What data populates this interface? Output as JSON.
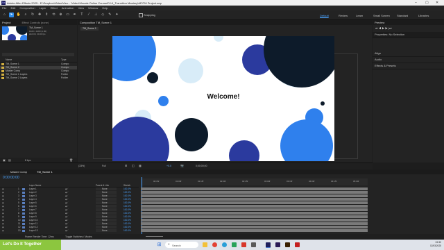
{
  "window": {
    "title": "Adobe After Effects 2025 - E:\\Dropbox\\Video\\Visu... \\Video\\Visuals Online Course\\D.UI_Transition Mastery\\AE\\TM Project.aep"
  },
  "menu": [
    "File",
    "Edit",
    "Composition",
    "Layer",
    "Effect",
    "Animation",
    "View",
    "Window",
    "Help"
  ],
  "toolbar": {
    "snapping_label": "Snapping"
  },
  "workspaces": [
    "Default",
    "Review",
    "Learn",
    "Small Screen",
    "Standard",
    "Libraries"
  ],
  "project": {
    "tab": "Project",
    "comp_name": "TM_Scene 1",
    "comp_info": [
      "1920 x 1080 (1.00)",
      "Δ10:00, 30.00 fps"
    ],
    "effect_controls_tab": "Effect Controls (none)",
    "col_name": "Name",
    "col_type": "Type",
    "items": [
      {
        "name": "TM_Scene 1",
        "type": "Compo",
        "color": "#d4b040",
        "selected": false
      },
      {
        "name": "TM_Scene 2",
        "type": "Compo",
        "color": "#d4b040",
        "selected": true
      },
      {
        "name": "Master Comp",
        "type": "Compo",
        "color": "#d4b040",
        "selected": false
      },
      {
        "name": "TM_Scene 1 Layers",
        "type": "Folder",
        "color": "#d4b040",
        "selected": false
      },
      {
        "name": "TM_Scene 2 Layers",
        "type": "Folder",
        "color": "#d4b040",
        "selected": false
      }
    ],
    "bpc": "8 bpc"
  },
  "viewer": {
    "tab": "Composition TM_Scene 1",
    "subtab": "TM_Scene 1",
    "welcome_text": "Welcome!",
    "zoom": "(33%)",
    "quality": "Full",
    "timecode": "0;00;00;00",
    "exposure": "+0.0"
  },
  "right_panel": {
    "preview_tab": "Preview",
    "properties_title": "Properties: No Selection",
    "sections": [
      "Align",
      "Audio",
      "Effects & Presets"
    ]
  },
  "timeline": {
    "tabs": [
      "Master Comp",
      "TM_Scene 1"
    ],
    "timecode": "0:00:00:00",
    "col_source": "Layer Name",
    "col_parent": "Parent & Link",
    "col_stretch": "Stretch",
    "ruler": [
      "00:15f",
      "01:00f",
      "01:15f",
      "02:00f",
      "02:15f",
      "03:00f",
      "03:15f",
      "04:00f",
      "04:15f",
      "05:00f"
    ],
    "layers": [
      {
        "num": "1",
        "name": "Layer 1",
        "parent": "None",
        "stretch": "100.0%"
      },
      {
        "num": "2",
        "name": "Layer 2",
        "parent": "None",
        "stretch": "100.0%"
      },
      {
        "num": "3",
        "name": "Layer 3",
        "parent": "None",
        "stretch": "100.0%"
      },
      {
        "num": "4",
        "name": "Layer 4",
        "parent": "None",
        "stretch": "100.0%"
      },
      {
        "num": "5",
        "name": "Layer 5",
        "parent": "None",
        "stretch": "100.0%"
      },
      {
        "num": "6",
        "name": "Layer 6",
        "parent": "None",
        "stretch": "100.0%"
      },
      {
        "num": "7",
        "name": "Layer 7",
        "parent": "None",
        "stretch": "100.0%"
      },
      {
        "num": "8",
        "name": "Layer 8",
        "parent": "None",
        "stretch": "100.0%"
      },
      {
        "num": "9",
        "name": "Layer 9",
        "parent": "None",
        "stretch": "100.0%"
      },
      {
        "num": "10",
        "name": "Layer 10",
        "parent": "None",
        "stretch": "100.0%"
      },
      {
        "num": "11",
        "name": "Layer 11",
        "parent": "None",
        "stretch": "100.0%"
      },
      {
        "num": "12",
        "name": "Layer 12",
        "parent": "None",
        "stretch": "100.0%"
      },
      {
        "num": "13",
        "name": "Layer 13",
        "parent": "None",
        "stretch": "100.0%"
      }
    ],
    "footer_left": "Frame Render Time: 12ms",
    "footer_mid": "Toggle Switches / Modes"
  },
  "taskbar": {
    "banner": "Let's Do It Together",
    "search_placeholder": "Search",
    "time": "13:32",
    "date": "02/03/2025"
  },
  "colors": {
    "accent": "#2d8ceb",
    "blue_circle": "#2f80ed",
    "navy_circle": "#2b3a9e",
    "dark_circle": "#0d1b2a",
    "light_circle": "#d8ecf8",
    "banner": "#8cc63f"
  }
}
